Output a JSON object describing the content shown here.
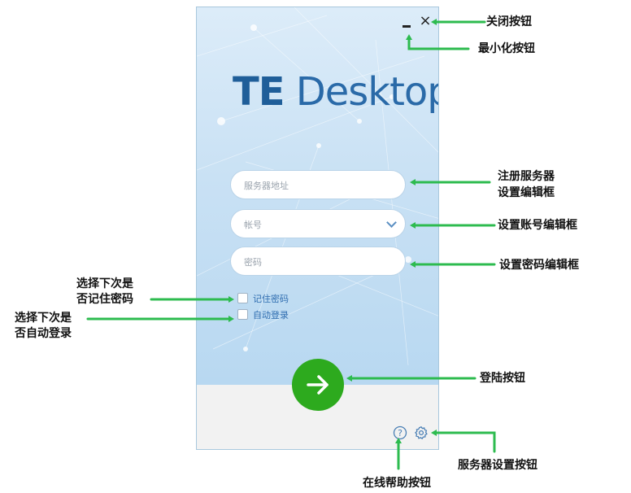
{
  "app": {
    "logo_bold": "TE",
    "logo_rest": " Desktop",
    "window_buttons": {
      "minimize_icon": "minimize-icon",
      "close_icon": "close-icon",
      "close_glyph": "×"
    },
    "fields": {
      "server_placeholder": "服务器地址",
      "account_placeholder": "帐号",
      "password_placeholder": "密码"
    },
    "checkboxes": {
      "remember_label": "记住密码",
      "remember_checked": false,
      "autologin_label": "自动登录",
      "autologin_checked": false
    },
    "login_icon": "arrow-right-icon",
    "help_glyph": "?",
    "colors": {
      "accent_blue": "#1f5e99",
      "login_green": "#2daa1e",
      "link_blue": "#2f6db0",
      "annotation_green": "#2dbb4f"
    }
  },
  "annotations": {
    "close": "关闭按钮",
    "minimize": "最小化按钮",
    "server_line1": "注册服务器",
    "server_line2": "设置编辑框",
    "account": "设置账号编辑框",
    "password": "设置密码编辑框",
    "remember_line1": "选择下次是",
    "remember_line2": "否记住密码",
    "autologin_line1": "选择下次是",
    "autologin_line2": "否自动登录",
    "login": "登陆按钮",
    "settings": "服务器设置按钮",
    "help": "在线帮助按钮"
  }
}
